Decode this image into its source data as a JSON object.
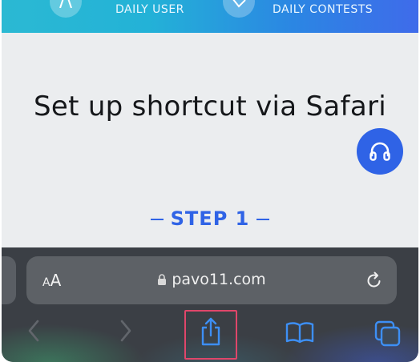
{
  "banner": {
    "items": [
      {
        "label": "DAILY USER",
        "icon": "user-icon"
      },
      {
        "label": "DAILY CONTESTS",
        "icon": "tag-icon"
      }
    ]
  },
  "main": {
    "title": "Set up shortcut via Safari",
    "step_label": "STEP 1",
    "support_icon": "headphones-icon"
  },
  "safari": {
    "text_size_label_small": "A",
    "text_size_label_big": "A",
    "url": "pavo11.com",
    "toolbar": [
      "back-icon",
      "forward-icon",
      "share-icon",
      "bookmarks-icon",
      "tabs-icon"
    ]
  },
  "colors": {
    "accent": "#2f63e6",
    "highlight_border": "#e0466a",
    "banner_start": "#2bb9d3",
    "banner_end": "#3f6bea"
  }
}
